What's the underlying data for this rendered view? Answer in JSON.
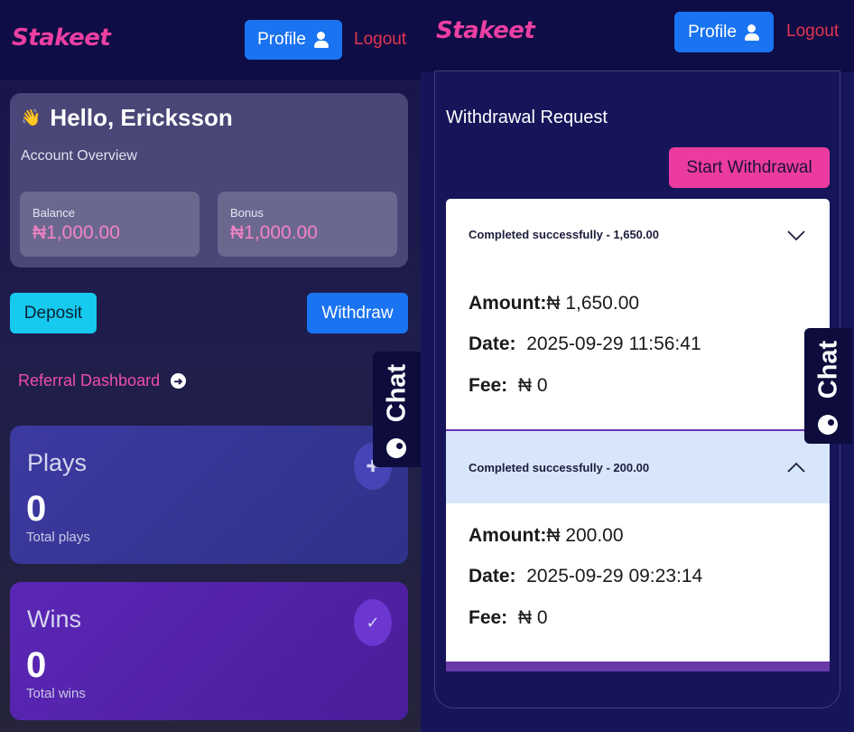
{
  "left": {
    "header": {
      "logo": "Stakeet",
      "profile_label": "Profile",
      "logout_label": "Logout"
    },
    "overview": {
      "greeting_icon": "👋",
      "greeting": "Hello, Ericksson",
      "subtitle": "Account Overview",
      "balance_label": "Balance",
      "balance_value": "₦1,000.00",
      "bonus_label": "Bonus",
      "bonus_value": "₦1,000.00"
    },
    "actions": {
      "deposit_label": "Deposit",
      "withdraw_label": "Withdraw"
    },
    "referral_label": "Referral Dashboard",
    "plays": {
      "title": "Plays",
      "value": "0",
      "caption": "Total plays"
    },
    "wins": {
      "title": "Wins",
      "value": "0",
      "caption": "Total wins"
    },
    "chat_label": "Chat"
  },
  "right": {
    "header": {
      "logo": "Stakeet",
      "profile_label": "Profile",
      "logout_label": "Logout"
    },
    "section_title": "Withdrawal Request",
    "start_label": "Start Withdrawal",
    "withdrawals": [
      {
        "summary": "Completed successfully - 1,650.00",
        "amount_label": "Amount:",
        "amount": "₦ 1,650.00",
        "date_label": "Date:",
        "date": "2025-09-29 11:56:41",
        "fee_label": "Fee:",
        "fee": "₦ 0"
      },
      {
        "summary": "Completed successfully - 200.00",
        "amount_label": "Amount:",
        "amount": "₦ 200.00",
        "date_label": "Date:",
        "date": "2025-09-29 09:23:14",
        "fee_label": "Fee:",
        "fee": "₦ 0"
      }
    ],
    "chat_label": "Chat"
  },
  "colors": {
    "brand_pink": "#ec3fa3",
    "primary_blue": "#1a73f0",
    "deposit_cyan": "#15c9ef",
    "logout_red": "#e3344f",
    "navy": "#0f0d45"
  }
}
